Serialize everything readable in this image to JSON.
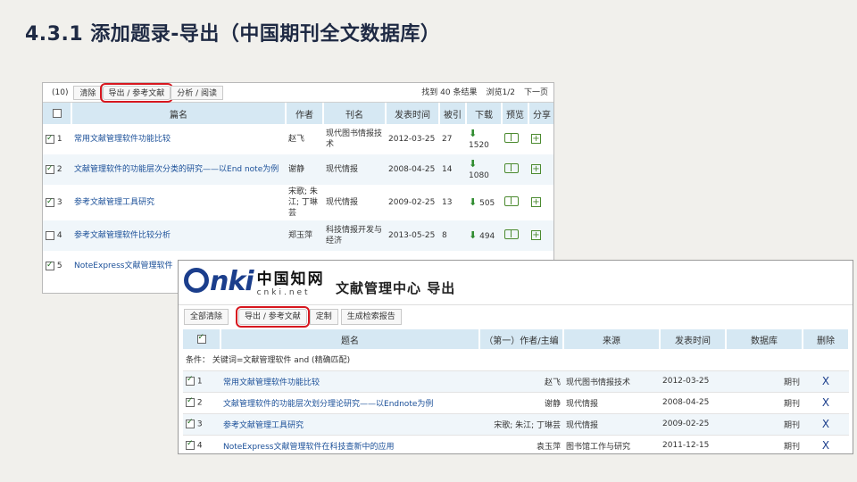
{
  "slide": {
    "title": "4.3.1  添加题录-导出（中国期刊全文数据库）"
  },
  "shot1": {
    "toolbar": {
      "count_badge": "(10)",
      "clear": "清除",
      "export": "导出 / 参考文献",
      "analysis": "分析 / 阅读",
      "found": "找到 40 条结果",
      "page": "浏览1/2",
      "next": "下一页"
    },
    "headers": [
      "",
      "篇名",
      "作者",
      "刊名",
      "发表时间",
      "被引",
      "下载",
      "预览",
      "分享"
    ],
    "rows": [
      {
        "num": "1",
        "title": "常用文献管理软件功能比较",
        "author": "赵飞",
        "journal": "现代图书情报技术",
        "date": "2012-03-25",
        "cited": "27",
        "downloads": "1520"
      },
      {
        "num": "2",
        "title": "文献管理软件的功能层次分类的研究——以End note为例",
        "author": "谢静",
        "journal": "现代情报",
        "date": "2008-04-25",
        "cited": "14",
        "downloads": "1080"
      },
      {
        "num": "3",
        "title": "参考文献管理工具研究",
        "author": "宋歌; 朱江; 丁琳芸",
        "journal": "现代情报",
        "date": "2009-02-25",
        "cited": "13",
        "downloads": "505"
      },
      {
        "num": "4",
        "title": "参考文献管理软件比较分析",
        "author": "郑玉萍",
        "journal": "科技情报开发与经济",
        "date": "2013-05-25",
        "cited": "8",
        "downloads": "494"
      },
      {
        "num": "5",
        "title": "NoteExpress文献管理软件",
        "author": "",
        "journal": "",
        "date": "",
        "cited": "",
        "downloads": ""
      }
    ]
  },
  "shot2": {
    "logo": {
      "brand": "nki",
      "chinese": "中国知网",
      "url": "cnki.net"
    },
    "title": "文献管理中心   导出",
    "toolbar": {
      "clear_all": "全部清除",
      "export": "导出 / 参考文献",
      "analysis": "定制",
      "report": "生成检索报告"
    },
    "headers": [
      "",
      "题名",
      "（第一）作者/主编",
      "来源",
      "发表时间",
      "数据库",
      "删除"
    ],
    "condition": "条件：  关键词=文献管理软件 and (精确匹配)",
    "rows": [
      {
        "num": "1",
        "title": "常用文献管理软件功能比较",
        "author": "赵飞",
        "source": "现代图书情报技术",
        "date": "2012-03-25",
        "db": "期刊",
        "del": "X"
      },
      {
        "num": "2",
        "title": "文献管理软件的功能层次划分理论研究——以Endnote为例",
        "author": "谢静",
        "source": "现代情报",
        "date": "2008-04-25",
        "db": "期刊",
        "del": "X"
      },
      {
        "num": "3",
        "title": "参考文献管理工具研究",
        "author": "宋歌; 朱江; 丁琳芸",
        "source": "现代情报",
        "date": "2009-02-25",
        "db": "期刊",
        "del": "X"
      },
      {
        "num": "4",
        "title": "NoteExpress文献管理软件在科技查新中的应用",
        "author": "袁玉萍",
        "source": "图书馆工作与研究",
        "date": "2011-12-15",
        "db": "期刊",
        "del": "X"
      }
    ]
  }
}
